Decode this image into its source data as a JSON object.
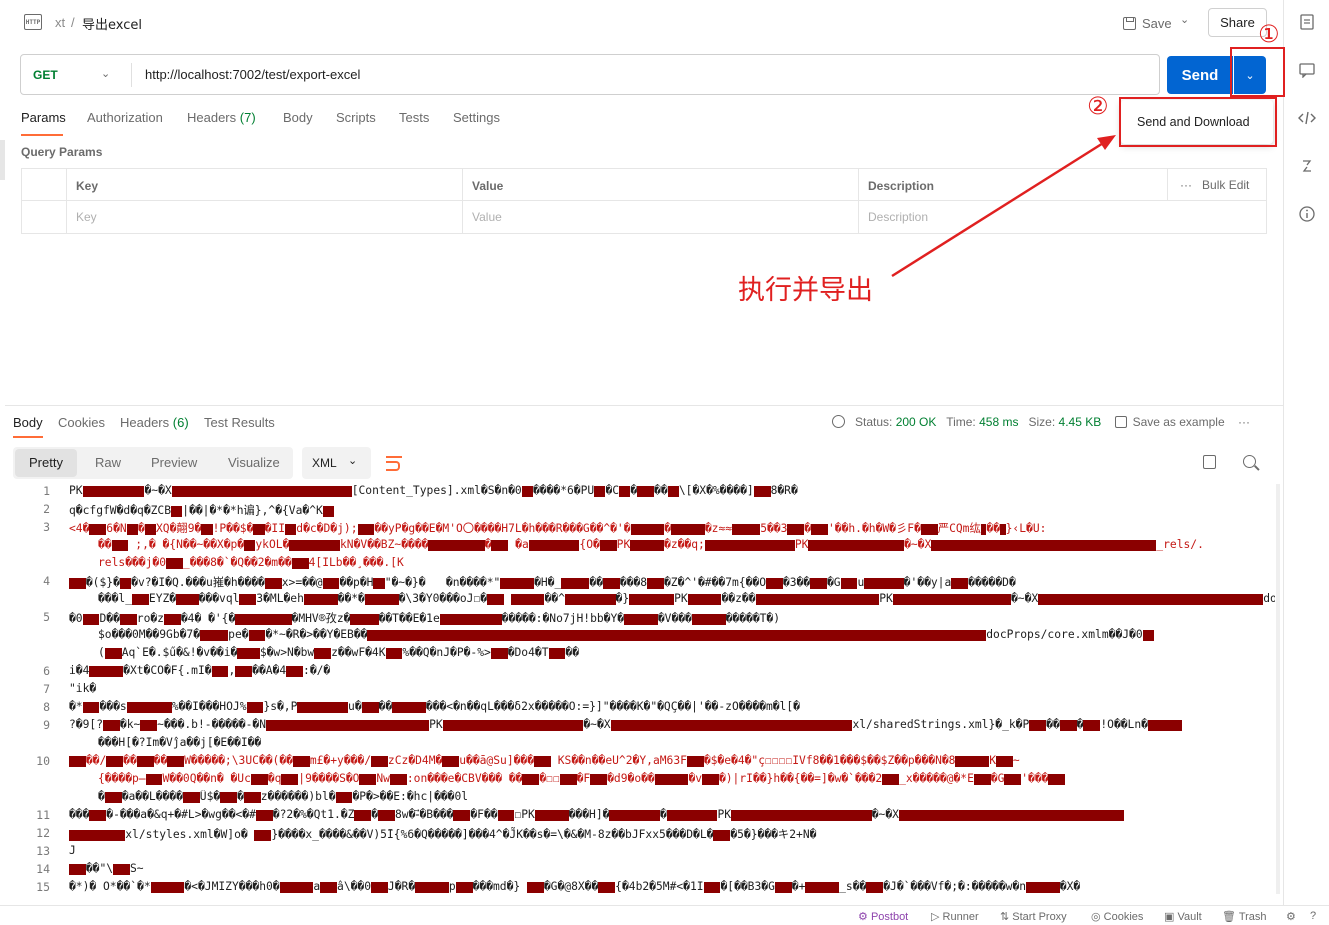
{
  "header": {
    "breadcrumb_parent": "xt",
    "breadcrumb_sep": "/",
    "breadcrumb_current": "导出excel",
    "http_icon": "HTTP",
    "save_label": "Save",
    "share_label": "Share"
  },
  "request": {
    "method": "GET",
    "url": "http://localhost:7002/test/export-excel",
    "send_label": "Send",
    "dropdown_item": "Send and Download"
  },
  "annotations": {
    "marker_1": "①",
    "marker_2": "②",
    "caption": "执行并导出",
    "color": "#e02020"
  },
  "request_tabs": [
    {
      "label": "Params"
    },
    {
      "label": "Authorization"
    },
    {
      "label": "Headers",
      "count": "(7)"
    },
    {
      "label": "Body"
    },
    {
      "label": "Scripts"
    },
    {
      "label": "Tests"
    },
    {
      "label": "Settings"
    }
  ],
  "query_params": {
    "title": "Query Params",
    "headers": {
      "key": "Key",
      "value": "Value",
      "description": "Description"
    },
    "bulk_edit": "Bulk Edit",
    "placeholders": {
      "key": "Key",
      "value": "Value",
      "description": "Description"
    }
  },
  "response_tabs": [
    {
      "label": "Body"
    },
    {
      "label": "Cookies"
    },
    {
      "label": "Headers",
      "count": "(6)"
    },
    {
      "label": "Test Results"
    }
  ],
  "response_meta": {
    "status_label": "Status:",
    "status_value": "200 OK",
    "time_label": "Time:",
    "time_value": "458 ms",
    "size_label": "Size:",
    "size_value": "4.45 KB",
    "save_example": "Save as example",
    "more": "···"
  },
  "view_modes": [
    "Pretty",
    "Raw",
    "Preview",
    "Visualize"
  ],
  "format": "XML",
  "code_lines": [
    {
      "num": "1",
      "text": "PK███████████�~�X████████████████████████████████[Content_Types].xml�S�n�0██����*6�PU██�C██�███��██\\[�X�%����]███8�R�",
      "style": ""
    },
    {
      "num": "2",
      "text": "q�cfgfW�d�q�ZCB██|��|�*�*h谝},^�{Va�^K██",
      "style": ""
    },
    {
      "num": "3",
      "text": "<4�███6�N██�██XQ�翸9�██!P��$�██�II██d�c�D�j);███��уP�g��E�M'O〇����H7L�h���R���G��^�'�██████�██████�z≈≈█████5��3███�███'��h.�h�W�彡F�███严CQm纮█��█}‹L�U:",
      "style": "red"
    },
    {
      "num": "",
      "text": "��███ ;,� �{N��~��X�p�██ykOL�█████████kN�V��BZ~����██████████�███ �a█████████{O�███PK██████�z��q;████████████████PK█████████████████�~�X████████████████████████████████████████_rels/.",
      "style": "red cont"
    },
    {
      "num": "",
      "text": "rels���j�0███_���8�`�Q��2�m��███4[ILb��¸���.[K",
      "style": "red cont"
    },
    {
      "num": "4",
      "text": "███�($}�██�v?�I�Q.���u嶊�h����███x>=��@███��p�H██\"�~�}�   �n����*\"██████�H�_█████��███���8███�Z�^'�#��7m{��O███�3��███�G███u███████�'��y|a███�����D�",
      "style": ""
    },
    {
      "num": "",
      "text": "���l_███EYZ�████���vql███3�ML�eh██████��*�██████�\\3�Y0���oJ☐�███ ██████��^█████████�}████████PK██████��z��██████████████████████PK█████████████████████�~�X████████████████████████████████████████docProps/app",
      "style": "cont"
    },
    {
      "num": "5",
      "text": "�0███D��███ro�z███�4� �'{�██████████�MHV®孜z�█████��T��E�1e███████████�����:�No7jH!bb�Y�██████�V���██████�����T�)",
      "style": ""
    },
    {
      "num": "",
      "text": "$o���0M��9Gb�7�█████pe�███�*~�R�>��Y�EB��██████████████████████████████████████████████████████████████████████████████████████████████████████████████docProps/core.xmlm��J�0██",
      "style": "cont"
    },
    {
      "num": "",
      "text": "(███Aq`E�.$ű�&!�v��i�████$�w>N�bw███z��wF�4K███%��Q�nJ�P�-%>███�Do4�T███��",
      "style": "cont"
    },
    {
      "num": "6",
      "text": "i�4██████�Xt�CO�F{.mI�███,███��A�4███:�/�",
      "style": ""
    },
    {
      "num": "7",
      "text": "\"ik�",
      "style": ""
    },
    {
      "num": "8",
      "text": "�*███���s████████%��I���HOJ%███}s�,P█████████u�███��██████���<�n��qL���δ2x�����O:=}]\"����K�\"�QÇ��|'��-zO����m�l[�",
      "style": ""
    },
    {
      "num": "9",
      "text": "?�9[?███�k~███~���.b!-�����-�N█████████████████████████████PK█████████████████████████�~�X███████████████████████████████████████████xl/sharedStrings.xml}�_k�P███��███�███!O��Ln�██████",
      "style": ""
    },
    {
      "num": "",
      "text": "���H[�?Im�Vĵa��j[�E��I��",
      "style": "cont"
    },
    {
      "num": "10",
      "text": "███��/███��███��███W�����;\\3UC��(��███m£�+y���/███zCz�D4M�███u��ā@Su]���███ KS��n��eU^2�Y,aM63F███�$�e�4�\"ç☐☐☐☐IVf8��1���$��$Z��p���N�8██████K███~",
      "style": "red"
    },
    {
      "num": "",
      "text": "{����p̶███W��0Q��n� �Uc███�q███|9����S�O███Nw███:on���e�CBV��� ��███�☐☐███�F███�d9�o��██████�v███�)|rI��}h��{��=]�w�`���2███_x�����@�*E███�G███'���███",
      "style": "red cont"
    },
    {
      "num": "",
      "text": "�███�a��L����███Ü$�███�███z������)bl�███�P�>��E:�hc|���0l",
      "style": "cont"
    },
    {
      "num": "11",
      "text": "���███�-���a�&q+�#L>�wg��<�#███�?2�%�Qt1.�Z███�███8w�-⃗�B���███�F��███☐PK██████���H]�█████████�█████████PK█████████████████████████�~�X████████████████████████████████████████",
      "style": ""
    },
    {
      "num": "12",
      "text": "██████████xl/styles.xml�W]o� ███}����x_����&��V)5̄I{%6�Q�����]���4^�J̃K��s�=\\�&�M-8z��bJFxx5���D�L�███�5�}���キ2+N�",
      "style": ""
    },
    {
      "num": "13",
      "text": "J",
      "style": ""
    },
    {
      "num": "14",
      "text": "███��\"\\███S~",
      "style": ""
    },
    {
      "num": "15",
      "text": "�*)� O*��`�*██████�<�JMIZY���h0�██████a███â\\��0███J�R�██████p███���md�} ███�G�@8X��███{�4b2�5M#<�1I███�[��B3�G███�+██████_s��███�J�`���Vf�;�:�����w�n██████�X�",
      "style": ""
    }
  ],
  "statusbar": [
    {
      "label": "Postbot"
    },
    {
      "label": "Runner"
    },
    {
      "label": "Start Proxy"
    },
    {
      "label": "Cookies"
    },
    {
      "label": "Vault"
    },
    {
      "label": "Trash"
    }
  ],
  "colors": {
    "send": "#0265d2",
    "method_get": "#007f31",
    "tab_accent": "#ff6c37",
    "status_ok": "#007f31",
    "postbot": "#8e44ad",
    "control_char_bg": "#8b0000"
  }
}
